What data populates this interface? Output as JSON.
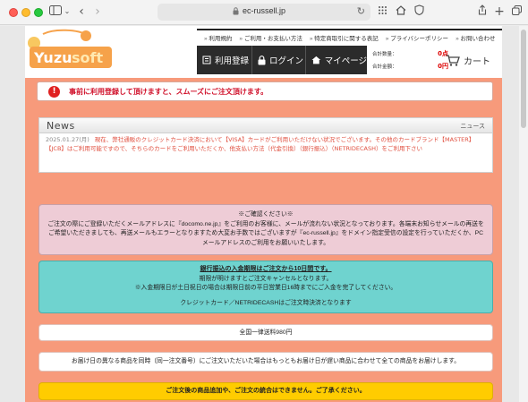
{
  "browser": {
    "url": "ec-russell.jp"
  },
  "header": {
    "logo_text": "YUZUSOFT",
    "nav": [
      "利用規約",
      "ご利用・お支払い方法",
      "特定商取引に関する表記",
      "プライバシーポリシー",
      "お問い合わせ"
    ],
    "register_label": "利用登録",
    "login_label": "ログイン",
    "mypage_label": "マイページ",
    "cart_count_label": "合計数量：",
    "cart_count_value": "0点",
    "cart_total_label": "合計金額：",
    "cart_total_value": "0円",
    "cart_label": "カート"
  },
  "notice": {
    "text": "事前に利用登録して頂けますと、スムーズにご注文頂けます。"
  },
  "news": {
    "title": "News",
    "title_jp": "ニュース",
    "date": "2025.01.27(月)",
    "body": "現在、弊社通販のクレジットカード決済において【VISA】カードがご利用いただけない状況でございます。その他のカードブランド【MASTER】【JCB】はご利用可能ですので、そちらのカードをご利用いただくか、他支払い方法（代金引換）（銀行振込）（NETRIDECASH）をご利用下さい"
  },
  "boxes": {
    "confirm_title": "※ご確認ください※",
    "confirm_line1": "ご注文の際にご登録いただくメールアドレスに『docomo.ne.jp』をご利用のお客様に、メールが流れない状況となっております。各端末お知らせメールの再送をご希望いただきましても、再送メールもエラーとなりますため大変お手数ではございますが『ec-russell.jp』をドメイン指定受信の設定を行っていただくか、PCメールアドレスのご利用をお願いいたします。",
    "bank_title": "銀行振込の入金期限はご注文から10日間です。",
    "bank_line1": "期限が明けますとご注文キャンセルとなります。",
    "bank_line2": "※入金期限日が土日祝日の場合は期限日前の平日営業日16時までにご入金を完了してください。",
    "bank_line3": "クレジットカード／NETRIDECASHはご注文時決済となります",
    "shipping": "全国一律送料980円",
    "bundle": "お届け日の異なる商品を同時（同一注文番号）にご注文いただいた場合はもっともお届け日が遅い商品に合わせて全ての商品をお届けします。",
    "warning": "ご注文後の商品追加や、ご注文の統合はできません。ご了承ください。"
  },
  "colors": {
    "site_bg": "#f79a7b",
    "alert_red": "#d0102a",
    "teal": "#6fd3cf",
    "yellow": "#ffcc00",
    "pink": "#eeccd6"
  }
}
